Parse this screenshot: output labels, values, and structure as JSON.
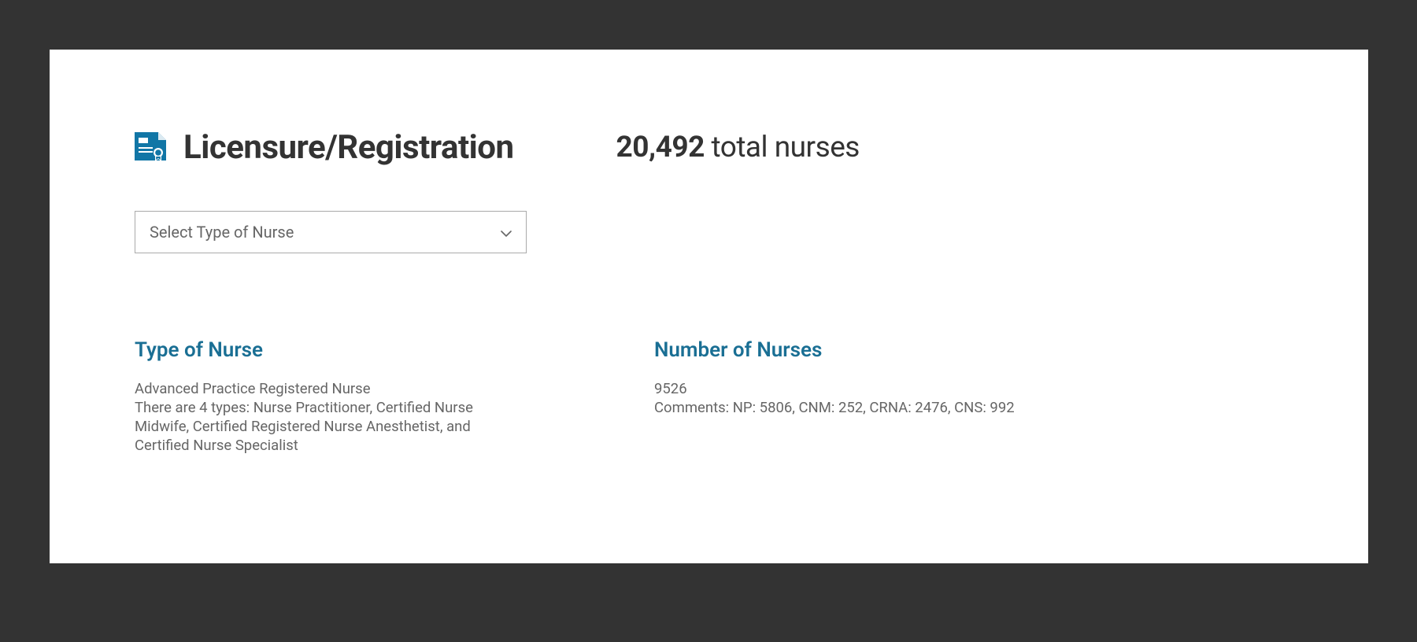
{
  "header": {
    "title": "Licensure/Registration",
    "total_number": "20,492",
    "total_label": " total nurses"
  },
  "select": {
    "placeholder": "Select Type of Nurse"
  },
  "columns": {
    "type": {
      "heading": "Type of Nurse",
      "name": "Advanced Practice Registered Nurse",
      "description": "There are 4 types: Nurse Practitioner, Certified Nurse Midwife, Certified Registered Nurse Anesthetist, and Certified Nurse Specialist"
    },
    "number": {
      "heading": "Number of Nurses",
      "value": "9526",
      "comments": "Comments: NP: 5806, CNM: 252, CRNA: 2476, CNS: 992"
    }
  },
  "colors": {
    "accent": "#1a6f94",
    "icon": "#1176a6"
  }
}
